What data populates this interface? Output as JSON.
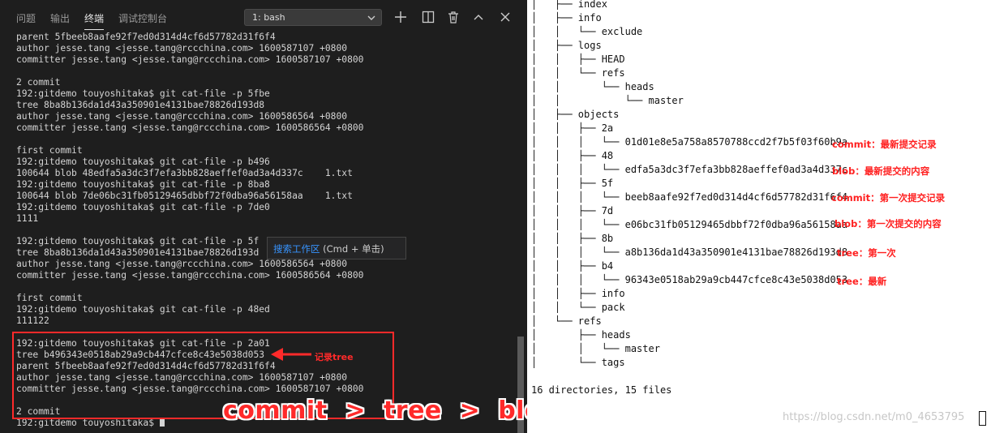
{
  "panel_tabs": [
    "问题",
    "输出",
    "终端",
    "调试控制台"
  ],
  "active_tab": "终端",
  "terminal_selector": "1: bash",
  "terminal_lines": [
    "parent 5fbeeb8aafe92f7ed0d314d4cf6d57782d31f6f4",
    "author jesse.tang <jesse.tang@rccchina.com> 1600587107 +0800",
    "committer jesse.tang <jesse.tang@rccchina.com> 1600587107 +0800",
    "",
    "2 commit",
    "192:gitdemo touyoshitaka$ git cat-file -p 5fbe",
    "tree 8ba8b136da1d43a350901e4131bae78826d193d8",
    "author jesse.tang <jesse.tang@rccchina.com> 1600586564 +0800",
    "committer jesse.tang <jesse.tang@rccchina.com> 1600586564 +0800",
    "",
    "first commit",
    "192:gitdemo touyoshitaka$ git cat-file -p b496",
    "100644 blob 48edfa5a3dc3f7efa3bb828aeffef0ad3a4d337c    1.txt",
    "192:gitdemo touyoshitaka$ git cat-file -p 8ba8",
    "100644 blob 7de06bc31fb05129465dbbf72f0dba96a56158aa    1.txt",
    "192:gitdemo touyoshitaka$ git cat-file -p 7de0",
    "1111",
    "",
    "192:gitdemo touyoshitaka$ git cat-file -p 5f",
    "tree 8ba8b136da1d43a350901e4131bae78826d193d",
    "author jesse.tang <jesse.tang@rccchina.com> 1600586564 +0800",
    "committer jesse.tang <jesse.tang@rccchina.com> 1600586564 +0800",
    "",
    "first commit",
    "192:gitdemo touyoshitaka$ git cat-file -p 48ed",
    "111122",
    "",
    "192:gitdemo touyoshitaka$ git cat-file -p 2a01",
    "tree b496343e0518ab29a9cb447cfce8c43e5038d053",
    "parent 5fbeeb8aafe92f7ed0d314d4cf6d57782d31f6f4",
    "author jesse.tang <jesse.tang@rccchina.com> 1600587107 +0800",
    "committer jesse.tang <jesse.tang@rccchina.com> 1600587107 +0800",
    "",
    "2 commit",
    "192:gitdemo touyoshitaka$ "
  ],
  "tooltip": {
    "link_text": "搜索工作区",
    "hint": " (Cmd + 单击)"
  },
  "annotations": {
    "record_tree": "记录tree",
    "chain": "commit  >  tree  >  blob"
  },
  "tree_lines": [
    "│   ├── index",
    "│   ├── info",
    "│   │   └── exclude",
    "│   ├── logs",
    "│   │   ├── HEAD",
    "│   │   └── refs",
    "│   │       └── heads",
    "│   │           └── master",
    "│   ├── objects",
    "│   │   ├── 2a",
    "│   │   │   └── 01d01e8e5a758a8570788ccd2f7b5f03f60b9a",
    "│   │   ├── 48",
    "│   │   │   └── edfa5a3dc3f7efa3bb828aeffef0ad3a4d337c",
    "│   │   ├── 5f",
    "│   │   │   └── beeb8aafe92f7ed0d314d4cf6d57782d31f6f4",
    "│   │   ├── 7d",
    "│   │   │   └── e06bc31fb05129465dbbf72f0dba96a56158aa",
    "│   │   ├── 8b",
    "│   │   │   └── a8b136da1d43a350901e4131bae78826d193d8",
    "│   │   ├── b4",
    "│   │   │   └── 96343e0518ab29a9cb447cfce8c43e5038d053",
    "│   │   ├── info",
    "│   │   └── pack",
    "│   └── refs",
    "│       ├── heads",
    "│       │   └── master",
    "│       └── tags",
    "",
    "16 directories, 15 files"
  ],
  "object_notes": [
    {
      "type": "commit",
      "sep": "：",
      "desc": "最新提交记录"
    },
    {
      "type": "blob",
      "sep": "：",
      "desc": "最新提交的内容"
    },
    {
      "type": "commit",
      "sep": "：",
      "desc": "第一次提交记录"
    },
    {
      "type": "blob",
      "sep": "：",
      "desc": "第一次提交的内容"
    },
    {
      "type": "tree",
      "sep": "：",
      "desc": "第一次"
    },
    {
      "type": "tree",
      "sep": "：",
      "desc": "最新"
    }
  ],
  "watermark": "https://blog.csdn.net/m0_4653795",
  "colors": {
    "terminal_bg": "#1e1e1e",
    "annotation_red": "#ff2a2a",
    "link_blue": "#3794ff"
  }
}
